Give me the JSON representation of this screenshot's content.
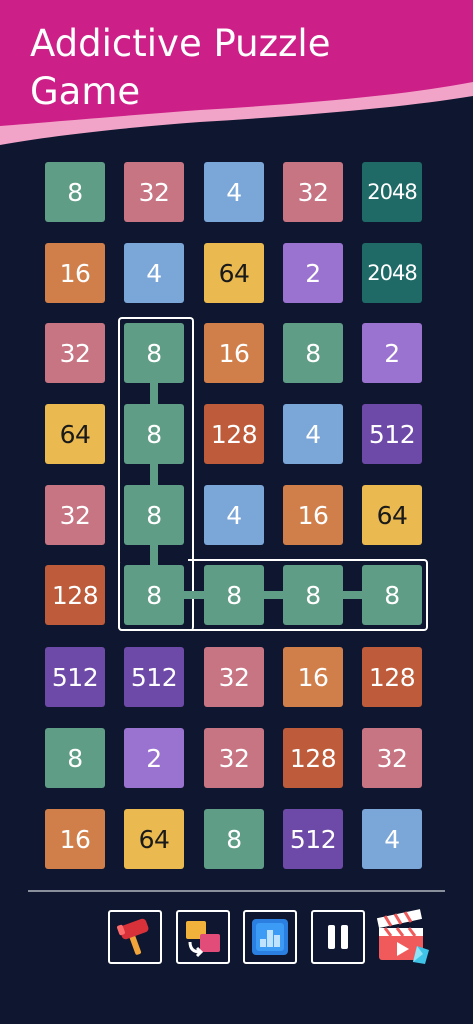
{
  "header": {
    "title": "Addictive Puzzle Game"
  },
  "colors": {
    "background": "#0f1730",
    "banner": "#cd1f88",
    "banner_highlight": "#f2a3c8",
    "8": "#5f9d86",
    "32": "#c77483",
    "4": "#7ba6d8",
    "2048": "#1f6a67",
    "16": "#d17f4a",
    "64": "#eab94f",
    "2": "#9a72d0",
    "128": "#bd5b3a",
    "512": "#6e4aa8"
  },
  "grid": {
    "rows": [
      [
        "8",
        "32",
        "4",
        "32",
        "2048"
      ],
      [
        "16",
        "4",
        "64",
        "2",
        "2048"
      ],
      [
        "32",
        "8",
        "16",
        "8",
        "2"
      ],
      [
        "64",
        "8",
        "128",
        "4",
        "512"
      ],
      [
        "32",
        "8",
        "4",
        "16",
        "64"
      ],
      [
        "128",
        "8",
        "8",
        "8",
        "8"
      ],
      [
        "512",
        "512",
        "32",
        "16",
        "128"
      ],
      [
        "8",
        "2",
        "32",
        "128",
        "32"
      ],
      [
        "16",
        "64",
        "8",
        "512",
        "4"
      ]
    ],
    "selected_path": [
      [
        2,
        1
      ],
      [
        3,
        1
      ],
      [
        4,
        1
      ],
      [
        5,
        1
      ],
      [
        5,
        2
      ],
      [
        5,
        3
      ],
      [
        5,
        4
      ]
    ]
  },
  "toolbar": {
    "buttons": [
      {
        "name": "hammer-button",
        "icon": "hammer-icon"
      },
      {
        "name": "swap-button",
        "icon": "swap-icon"
      },
      {
        "name": "leaderboard-button",
        "icon": "leaderboard-icon"
      },
      {
        "name": "pause-button",
        "icon": "pause-icon"
      },
      {
        "name": "video-reward-button",
        "icon": "video-clapper-icon"
      }
    ]
  }
}
